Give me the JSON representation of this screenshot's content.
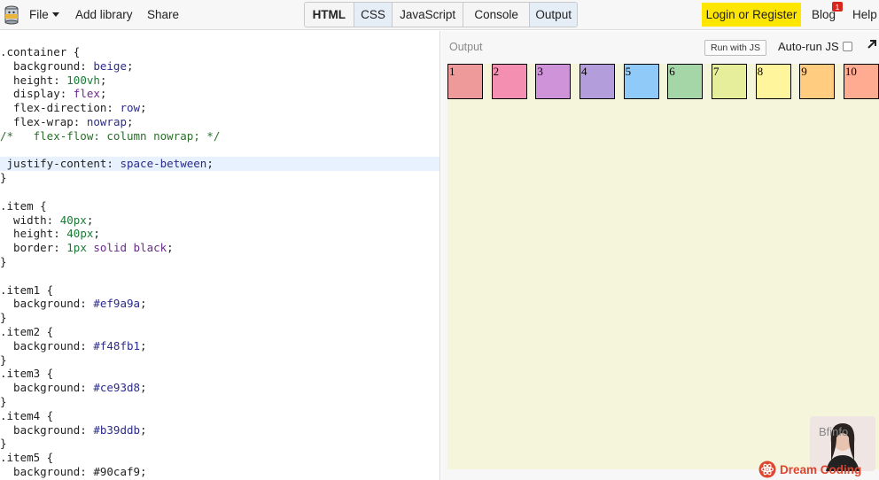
{
  "topbar": {
    "menu": {
      "file": "File",
      "add_library": "Add library",
      "share": "Share"
    },
    "tabs": [
      "HTML",
      "CSS",
      "JavaScript",
      "Console",
      "Output"
    ],
    "login": "Login or Register",
    "blog": "Blog",
    "blog_badge": "1",
    "help": "Help"
  },
  "editor": {
    "lines": [
      [
        [
          ".container {",
          "sel"
        ]
      ],
      [
        [
          "  background: ",
          "prop"
        ],
        [
          "beige",
          "val"
        ],
        [
          ";",
          "punc"
        ]
      ],
      [
        [
          "  height: ",
          "prop"
        ],
        [
          "100vh",
          "num"
        ],
        [
          ";",
          "punc"
        ]
      ],
      [
        [
          "  display: ",
          "prop"
        ],
        [
          "flex",
          "kw"
        ],
        [
          ";",
          "punc"
        ]
      ],
      [
        [
          "  flex-direction: ",
          "prop"
        ],
        [
          "row",
          "val"
        ],
        [
          ";",
          "punc"
        ]
      ],
      [
        [
          "  flex-wrap: ",
          "prop"
        ],
        [
          "nowrap",
          "val"
        ],
        [
          ";",
          "punc"
        ]
      ],
      [
        [
          "/*   flex-flow: column nowrap; */",
          "com"
        ]
      ],
      [],
      [
        [
          " justify-content: ",
          "prop"
        ],
        [
          "space-between",
          "val"
        ],
        [
          ";",
          "punc"
        ]
      ],
      [
        [
          "}",
          "punc"
        ]
      ],
      [],
      [
        [
          ".item {",
          "sel"
        ]
      ],
      [
        [
          "  width: ",
          "prop"
        ],
        [
          "40px",
          "num"
        ],
        [
          ";",
          "punc"
        ]
      ],
      [
        [
          "  height: ",
          "prop"
        ],
        [
          "40px",
          "num"
        ],
        [
          ";",
          "punc"
        ]
      ],
      [
        [
          "  border: ",
          "prop"
        ],
        [
          "1px",
          "num"
        ],
        [
          " solid black",
          "kw"
        ],
        [
          ";",
          "punc"
        ]
      ],
      [
        [
          "}",
          "punc"
        ]
      ],
      [],
      [
        [
          ".item1 {",
          "sel"
        ]
      ],
      [
        [
          "  background: ",
          "prop"
        ],
        [
          "#ef9a9a",
          "val"
        ],
        [
          ";",
          "punc"
        ]
      ],
      [
        [
          "}",
          "punc"
        ]
      ],
      [
        [
          ".item2 {",
          "sel"
        ]
      ],
      [
        [
          "  background: ",
          "prop"
        ],
        [
          "#f48fb1",
          "val"
        ],
        [
          ";",
          "punc"
        ]
      ],
      [
        [
          "}",
          "punc"
        ]
      ],
      [
        [
          ".item3 {",
          "sel"
        ]
      ],
      [
        [
          "  background: ",
          "prop"
        ],
        [
          "#ce93d8",
          "val"
        ],
        [
          ";",
          "punc"
        ]
      ],
      [
        [
          "}",
          "punc"
        ]
      ],
      [
        [
          ".item4 {",
          "sel"
        ]
      ],
      [
        [
          "  background: ",
          "prop"
        ],
        [
          "#b39ddb",
          "val"
        ],
        [
          ";",
          "punc"
        ]
      ],
      [
        [
          "}",
          "punc"
        ]
      ],
      [
        [
          ".item5 {",
          "sel"
        ]
      ],
      [
        [
          "  background: #90caf9;",
          "prop"
        ]
      ]
    ],
    "active_line": 8
  },
  "output": {
    "label": "Output",
    "run_button": "Run with JS",
    "autorun_label": "Auto-run JS",
    "autorun_checked": false,
    "items": [
      {
        "label": "1",
        "color": "#ef9a9a"
      },
      {
        "label": "2",
        "color": "#f48fb1"
      },
      {
        "label": "3",
        "color": "#ce93d8"
      },
      {
        "label": "4",
        "color": "#b39ddb"
      },
      {
        "label": "5",
        "color": "#90caf9"
      },
      {
        "label": "6",
        "color": "#a5d6a7"
      },
      {
        "label": "7",
        "color": "#e6ee9c"
      },
      {
        "label": "8",
        "color": "#fff59d"
      },
      {
        "label": "9",
        "color": "#ffcc80"
      },
      {
        "label": "10",
        "color": "#ffab91"
      }
    ]
  },
  "watermark": {
    "text": "Dream Coding",
    "webcam_text": "Bfinfo"
  }
}
